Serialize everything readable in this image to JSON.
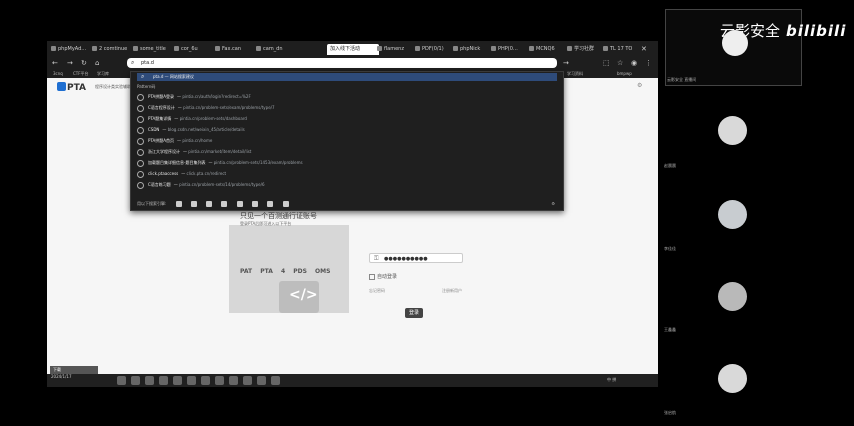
{
  "browser": {
    "tabs": [
      "phpMyAd…",
      "2 comtinue",
      "some_title",
      "cor_6u",
      "Fax.can",
      "cam_dn",
      "加入线下活动",
      "flamenz",
      "PDF(0/1)",
      "phpNick",
      "PHP(0…",
      "MCNQ6",
      "学习社群",
      "TL 17 TO"
    ],
    "address": "pta.d",
    "bookmarks": [
      "3cnq",
      "CTF平台",
      "学习库",
      "刷题网站",
      "工具集",
      "学习资料",
      "其他收藏"
    ],
    "right_badge": "bmpwp"
  },
  "dropdown": {
    "query_label": "pta.d — 网站搜索建议",
    "heading": "Pattern码",
    "rows": [
      {
        "title": "PTA拼题A登录",
        "url": "pintia.cn/auth/login?redirect=%2F"
      },
      {
        "title": "C语言程序设计",
        "url": "pintia.cn/problem-sets/exam/problems/type/7"
      },
      {
        "title": "PTA题集详情",
        "url": "pintia.cn/problem-sets/dashboard"
      },
      {
        "title": "CSDN",
        "url": "blog.csdn.net/weixin_45/article/details"
      },
      {
        "title": "PTA拼题A首页",
        "url": "pintia.cn/home"
      },
      {
        "title": "浙江大学程序设计",
        "url": "pintia.cn/market/item/detail/list"
      },
      {
        "title": "加载题目集详细信息-题目集列表",
        "url": "pintia.cn/problem-sets/1453/exam/problems"
      },
      {
        "title": "click.ptaaccess",
        "url": "click.pta.cn/redirect"
      },
      {
        "title": "C语言练习题",
        "url": "pintia.cn/problem-sets/14/problems/type/6"
      }
    ],
    "footer": "用以下搜索引擎:"
  },
  "pta": {
    "logo": "PTA",
    "subtitle": "程序设计类实验辅助教学平台",
    "slogan": "只见一个百测通行证账号",
    "slogan_sub": "登录PTA后即可进入以下平台",
    "platforms": "PAT PTA 4 PDS OMS",
    "password_mask": "●●●●●●●●●●",
    "remember": "自动登录",
    "link_left": "忘记密码",
    "link_right": "注册新用户",
    "login": "登录",
    "download": "下载"
  },
  "taskbar": {
    "date": "2024/1/17",
    "tray": "中 拼"
  },
  "watermark": {
    "brand": "云影安全",
    "bili": "bilibili"
  },
  "participants": {
    "speaker": "云影安全 直播间",
    "names": [
      "赵晨晨",
      "李佳佳",
      "王鑫鑫",
      "张启航"
    ]
  },
  "colors": {
    "accent": "#1f6fd1",
    "dropdown_bg": "#1f1f1f",
    "page_bg": "#f6f6f6"
  }
}
